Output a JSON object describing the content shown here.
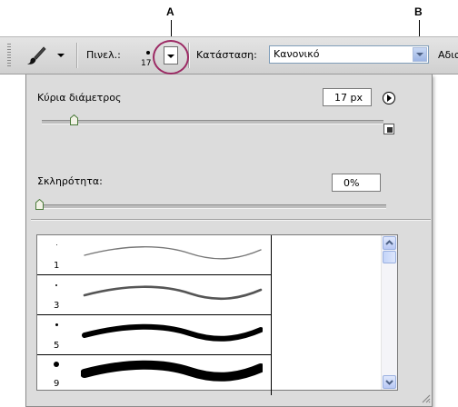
{
  "callouts": {
    "a": "A",
    "b": "B"
  },
  "options_bar": {
    "brush_label": "Πινελ.:",
    "brush_size_value": "17",
    "mode_label": "Κατάσταση:",
    "mode_value": "Κανονικό",
    "opacity_label_partial": "Αδια"
  },
  "panel": {
    "master_diameter_label": "Κύρια διάμετρος",
    "master_diameter_value": "17 px",
    "master_diameter_slider": 0.17,
    "hardness_label": "Σκληρότητα:",
    "hardness_value": "0%",
    "hardness_slider": 0.0
  },
  "presets": [
    {
      "size_label": "1",
      "dot_diameter": 1
    },
    {
      "size_label": "3",
      "dot_diameter": 2
    },
    {
      "size_label": "5",
      "dot_diameter": 3
    },
    {
      "size_label": "9",
      "dot_diameter": 6
    }
  ],
  "colors": {
    "highlight_ring": "#9c2a64",
    "panel_bg": "#dcdcdc",
    "optbar_bg": "#d8d8d8",
    "scrollbar_button": "#b8c8f4"
  },
  "icons": {
    "tool": "brush-tool-icon",
    "flyout": "panel-menu-arrow-icon",
    "new_preset": "new-preset-icon",
    "scroll_up": "chevron-up-icon",
    "scroll_down": "chevron-down-icon",
    "resize": "resize-grip-icon"
  }
}
